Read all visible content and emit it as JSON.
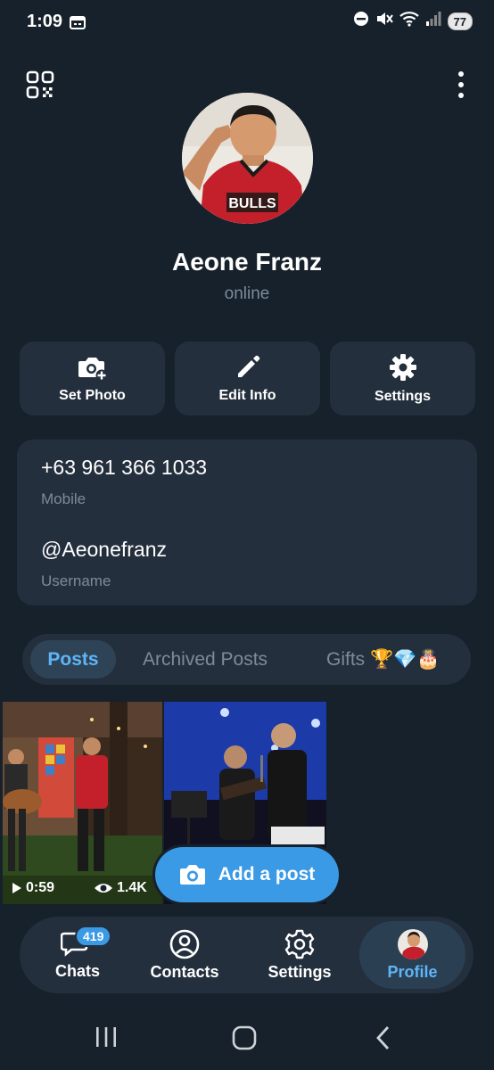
{
  "status_bar": {
    "time": "1:09",
    "battery": "77"
  },
  "profile": {
    "name": "Aeone Franz",
    "status": "online"
  },
  "actions": [
    {
      "label": "Set Photo",
      "icon": "camera-plus-icon"
    },
    {
      "label": "Edit Info",
      "icon": "pencil-icon"
    },
    {
      "label": "Settings",
      "icon": "gear-icon"
    }
  ],
  "info": {
    "phone": "+63 961 366 1033",
    "phone_label": "Mobile",
    "username": "@Aeonefranz",
    "username_label": "Username"
  },
  "tabs": {
    "posts": "Posts",
    "archived": "Archived Posts",
    "gifts": "Gifts 🏆💎🎂"
  },
  "posts": [
    {
      "duration": "0:59",
      "views": "1.4K"
    }
  ],
  "add_post": {
    "label": "Add a post"
  },
  "bottom_nav": {
    "chats": "Chats",
    "chats_badge": "419",
    "contacts": "Contacts",
    "settings": "Settings",
    "profile": "Profile"
  },
  "colors": {
    "background": "#17212b",
    "card": "#242f3d",
    "accent": "#5eb5f7",
    "button": "#3a9ae6"
  }
}
